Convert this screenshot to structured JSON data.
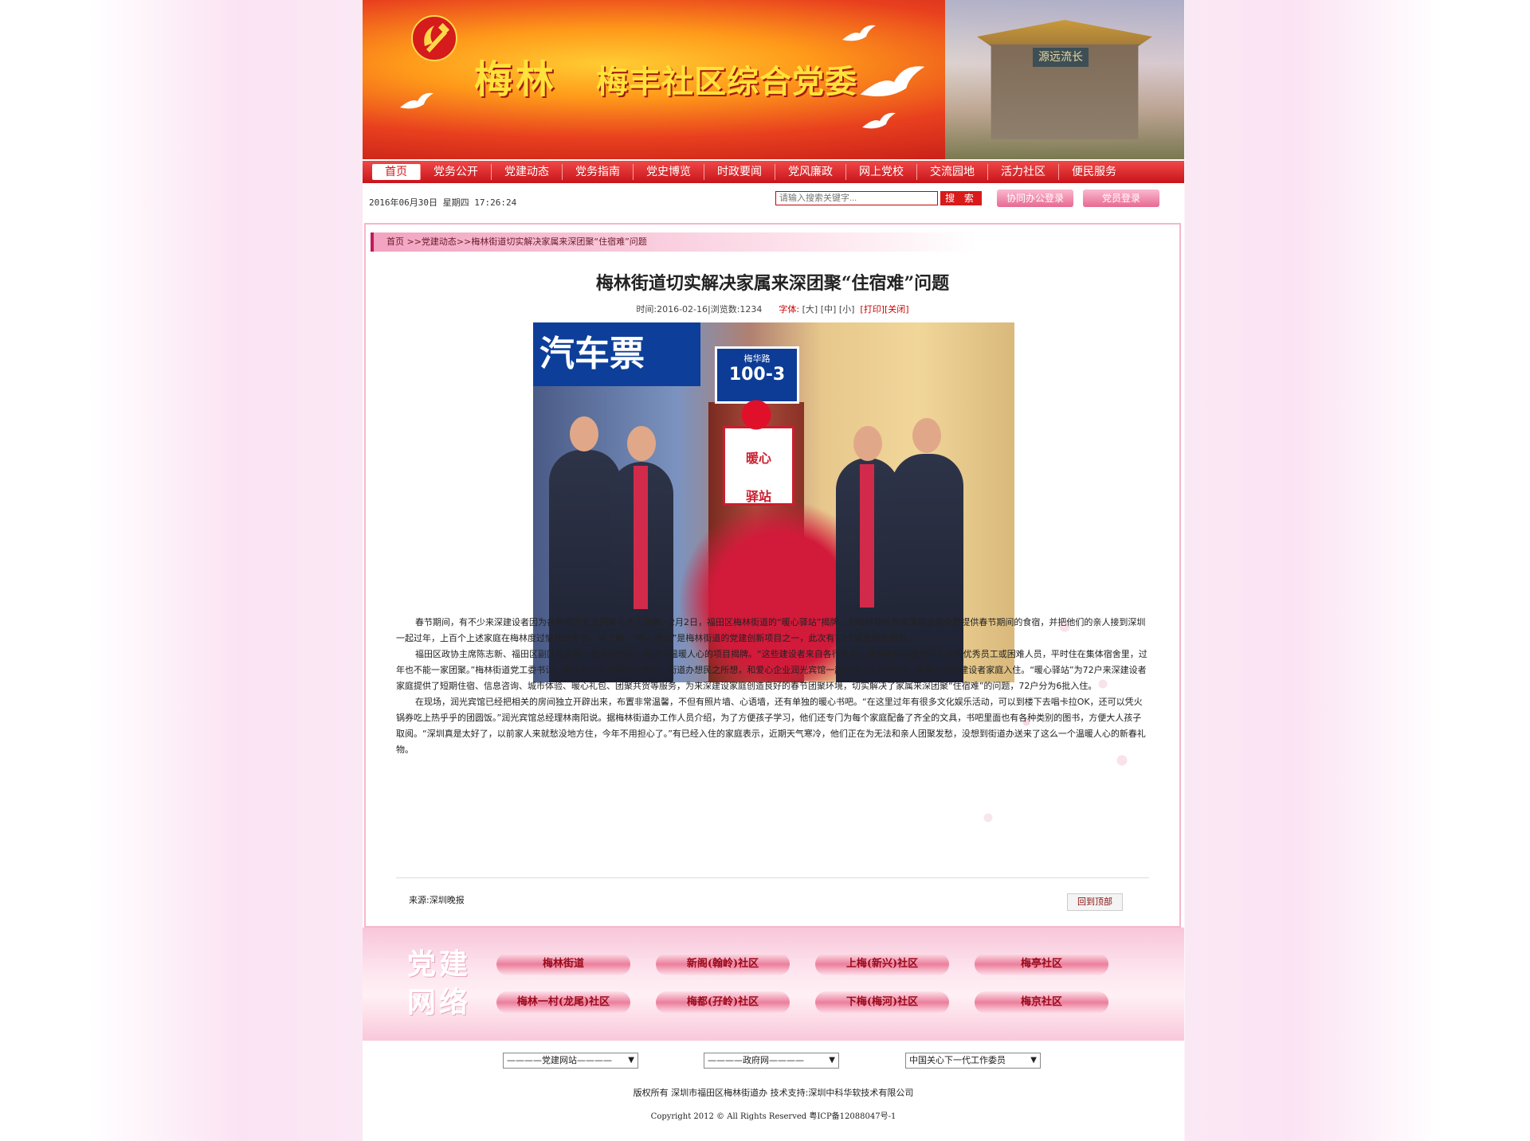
{
  "banner": {
    "title_script": "梅林",
    "title_main": "梅丰社区综合党委",
    "gate_sign": "源远流长"
  },
  "nav": {
    "items": [
      "首页",
      "党务公开",
      "党建动态",
      "党务指南",
      "党史博览",
      "时政要闻",
      "党风廉政",
      "网上党校",
      "交流园地",
      "活力社区",
      "便民服务"
    ],
    "active_index": 0
  },
  "toolbar": {
    "date": "2016年06月30日  星期四 17:26:24",
    "search_placeholder": "请输入搜索关键字...",
    "search_button": "搜 索",
    "login_office": "协同办公登录",
    "login_member": "党员登录"
  },
  "breadcrumb": {
    "home": "首页",
    "section": " >>党建动态>>",
    "current": "梅林街道切实解决家属来深团聚“住宿难”问题"
  },
  "article": {
    "title": "梅林街道切实解决家属来深团聚“住宿难”问题",
    "meta_time": "时间:2016-02-16|浏览数:1234",
    "font_label": "字体:",
    "font_large": "[大]",
    "font_medium": "[中]",
    "font_small": "[小]",
    "print": "[打印]",
    "close": "[关闭]",
    "photo": {
      "sign_text": "汽车票",
      "plate_road": "梅华路",
      "plate_number": "100-3",
      "board_text_1": "暖心",
      "board_text_2": "驿站"
    },
    "paragraphs": [
      "春节期间，有不少来深建设者因为各种原因无法回家与亲人团聚。2月2日，福田区梅林街道的“暖心驿站”揭牌，为梅林辖区的来深建设者免费提供春节期间的食宿，并把他们的亲人接到深圳一起过年，上百个上述家庭在梅林度过愉快的春节。据了解，“暖心驿站”是梅林街道的党建创新项目之一，此次有72个家庭因此受益。",
      "福田区政协主席陈志新、福田区副区长夏扬一起来到现场，为这个温暖人心的项目揭牌。“这些建设者来自各行各业，都是梅林街道辖区企业的优秀员工或困难人员，平时住在集体宿舍里，过年也不能一家团聚。”梅林街道党工委书记、街道办主任邵建平介绍说，街道办想民之所想，和爱心企业润光宾馆一起推出了12间房间，免费让来深建设者家庭入住。“暖心驿站”为72户来深建设者家庭提供了短期住宿、信息咨询、城市体验、暖心礼包、团聚共贺等服务，为来深建设家庭创造良好的春节团聚环境，切实解决了家属来深团聚“住宿难”的问题，72户分为6批入住。",
      "在现场，润光宾馆已经把相关的房间独立开辟出来，布置非常温馨，不但有照片墙、心语墙，还有单独的暖心书吧。“在这里过年有很多文化娱乐活动，可以到楼下去唱卡拉OK，还可以凭火锅券吃上热乎乎的团圆饭。”润光宾馆总经理林南阳说。据梅林街道办工作人员介绍，为了方便孩子学习，他们还专门为每个家庭配备了齐全的文具，书吧里面也有各种类别的图书，方便大人孩子取阅。“深圳真是太好了，以前家人来就愁没地方住，今年不用担心了。”有已经入住的家庭表示，近期天气寒冷，他们正在为无法和亲人团聚发愁，没想到街道办送来了这么一个温暖人心的新春礼物。"
    ],
    "source": "来源:深圳晚报",
    "back_to_top": "回到顶部"
  },
  "party_network": {
    "label_1": "党建",
    "label_2": "网络",
    "links": [
      "梅林街道",
      "新阁(翰岭)社区",
      "上梅(新兴)社区",
      "梅亭社区",
      "梅林一村(龙尾)社区",
      "梅都(孖岭)社区",
      "下梅(梅河)社区",
      "梅京社区"
    ]
  },
  "footer": {
    "select_party": "————党建网站————",
    "select_gov": "————政府网————",
    "select_org": "中国关心下一代工作委员",
    "copyright": "版权所有  深圳市福田区梅林街道办  技术支持:深圳中科华软技术有限公司",
    "copyright2": "Copyright 2012 © All Rights Reserved    粤ICP备12088047号-1"
  },
  "colors": {
    "party_red": "#d01818",
    "accent_pink": "#ec7e9c",
    "link_red": "#c00000"
  }
}
